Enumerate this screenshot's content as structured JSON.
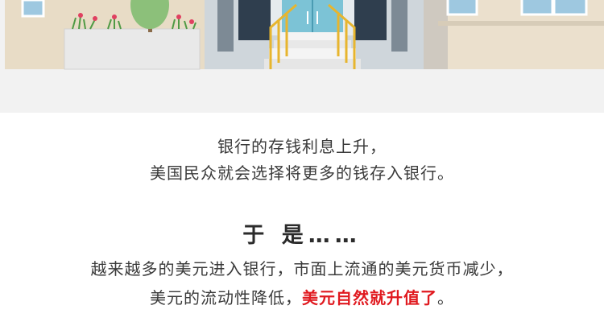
{
  "paragraph1": {
    "line1": "银行的存钱利息上升，",
    "line2": "美国民众就会选择将更多的钱存入银行。"
  },
  "heading": "于 是……",
  "paragraph2": {
    "line1": "越来越多的美元进入银行，市面上流通的美元货币减少，",
    "line2_prefix": "美元的流动性降低，",
    "line2_highlight": "美元自然就升值了",
    "line2_suffix": "。"
  },
  "colors": {
    "highlight": "#e0191f",
    "text": "#3a3a3a",
    "scene_background": "#f2f2f2"
  },
  "icons": [
    "bank-building-illustration",
    "tree-icon",
    "flower-planter-icon",
    "stair-railing-icon"
  ]
}
